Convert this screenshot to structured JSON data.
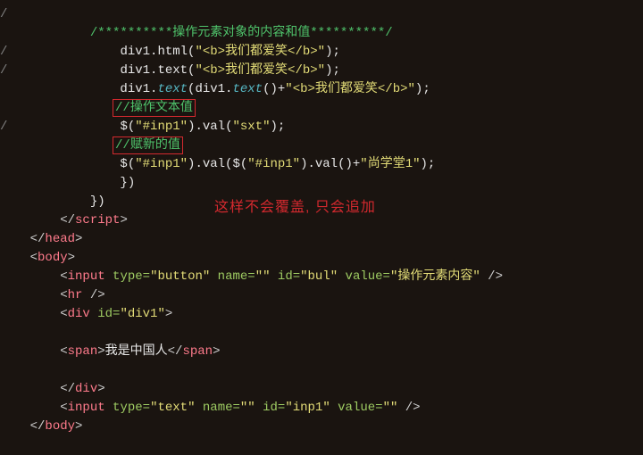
{
  "annotation": "这样不会覆盖, 只会追加",
  "code": {
    "l0_prefix": "/",
    "l1_comment": "/**********操作元素对象的内容和值**********/",
    "l2_prefix": "/",
    "l2a": "div1.html(",
    "l2b": "\"<b>我们都爱笑</b>\"",
    "l2c": ");",
    "l3_prefix": "/",
    "l3a": "div1.text(",
    "l3b": "\"<b>我们都爱笑</b>\"",
    "l3c": ");",
    "l4a": "div1.",
    "l4b": "text",
    "l4c": "(div1.",
    "l4d": "text",
    "l4e": "()+",
    "l4f": "\"<b>我们都爱笑</b>\"",
    "l4g": ");",
    "l5_comment": "//操作文本值",
    "l6_prefix": "/",
    "l6a": "$(",
    "l6b": "\"#inp1\"",
    "l6c": ").val(",
    "l6d": "\"sxt\"",
    "l6e": ");",
    "l7_comment": "//赋新的值",
    "l8a": "$(",
    "l8b": "\"#inp1\"",
    "l8c": ").val($(",
    "l8d": "\"#inp1\"",
    "l8e": ").val()+",
    "l8f": "\"尚学堂1\"",
    "l8g": ");",
    "l9": "})",
    "l10": "})",
    "l11_open": "</",
    "l11_tag": "script",
    "l11_close": ">",
    "l12_open": "</",
    "l12_tag": "head",
    "l12_close": ">",
    "l13_open": "<",
    "l13_tag": "body",
    "l13_close": ">",
    "l14_open": "<",
    "l14_tag": "input",
    "l14_attrs": " type=",
    "l14_v1": "\"button\"",
    "l14_a2": " name=",
    "l14_v2": "\"\"",
    "l14_a3": " id=",
    "l14_v3": "\"bul\"",
    "l14_a4": " value=",
    "l14_v4": "\"操作元素内容\"",
    "l14_close": " />",
    "l15_open": "<",
    "l15_tag": "hr",
    "l15_close": " />",
    "l16_open": "<",
    "l16_tag": "div",
    "l16_attrs": " id=",
    "l16_v1": "\"div1\"",
    "l16_close": ">",
    "l17_open": "<",
    "l17_tag": "span",
    "l17_close1": ">",
    "l17_text": "我是中国人",
    "l17_open2": "</",
    "l17_close2": ">",
    "l18_open": "</",
    "l18_tag": "div",
    "l18_close": ">",
    "l19_open": "<",
    "l19_tag": "input",
    "l19_a1": " type=",
    "l19_v1": "\"text\"",
    "l19_a2": " name=",
    "l19_v2": "\"\"",
    "l19_a3": " id=",
    "l19_v3": "\"inp1\"",
    "l19_a4": " value=",
    "l19_v4": "\"\"",
    "l19_close": " />",
    "l20_open": "</",
    "l20_tag": "body",
    "l20_close": ">"
  }
}
